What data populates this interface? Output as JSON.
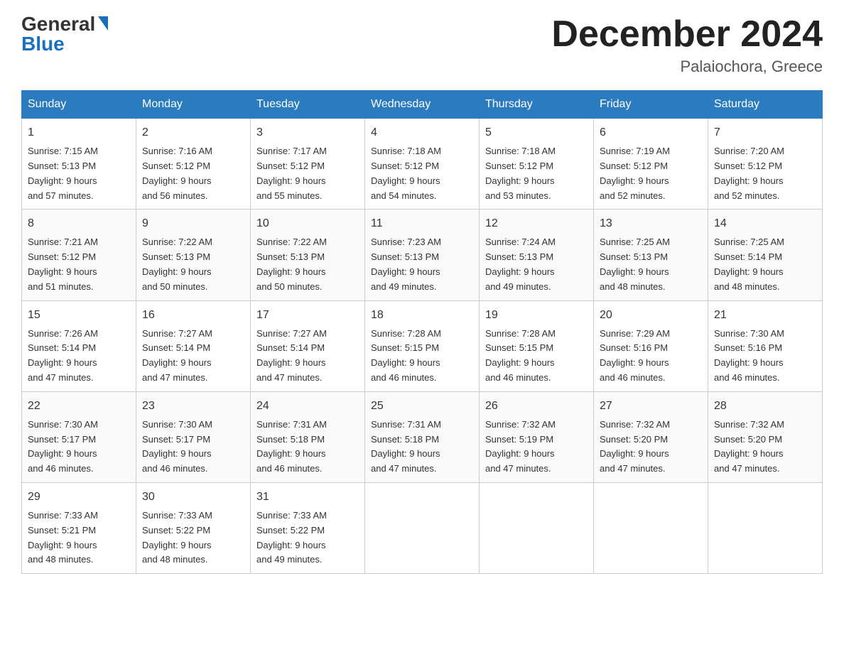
{
  "header": {
    "logo_general": "General",
    "logo_blue": "Blue",
    "month_title": "December 2024",
    "location": "Palaiochora, Greece"
  },
  "weekdays": [
    "Sunday",
    "Monday",
    "Tuesday",
    "Wednesday",
    "Thursday",
    "Friday",
    "Saturday"
  ],
  "weeks": [
    [
      {
        "day": "1",
        "sunrise": "7:15 AM",
        "sunset": "5:13 PM",
        "daylight": "9 hours and 57 minutes."
      },
      {
        "day": "2",
        "sunrise": "7:16 AM",
        "sunset": "5:12 PM",
        "daylight": "9 hours and 56 minutes."
      },
      {
        "day": "3",
        "sunrise": "7:17 AM",
        "sunset": "5:12 PM",
        "daylight": "9 hours and 55 minutes."
      },
      {
        "day": "4",
        "sunrise": "7:18 AM",
        "sunset": "5:12 PM",
        "daylight": "9 hours and 54 minutes."
      },
      {
        "day": "5",
        "sunrise": "7:18 AM",
        "sunset": "5:12 PM",
        "daylight": "9 hours and 53 minutes."
      },
      {
        "day": "6",
        "sunrise": "7:19 AM",
        "sunset": "5:12 PM",
        "daylight": "9 hours and 52 minutes."
      },
      {
        "day": "7",
        "sunrise": "7:20 AM",
        "sunset": "5:12 PM",
        "daylight": "9 hours and 52 minutes."
      }
    ],
    [
      {
        "day": "8",
        "sunrise": "7:21 AM",
        "sunset": "5:12 PM",
        "daylight": "9 hours and 51 minutes."
      },
      {
        "day": "9",
        "sunrise": "7:22 AM",
        "sunset": "5:13 PM",
        "daylight": "9 hours and 50 minutes."
      },
      {
        "day": "10",
        "sunrise": "7:22 AM",
        "sunset": "5:13 PM",
        "daylight": "9 hours and 50 minutes."
      },
      {
        "day": "11",
        "sunrise": "7:23 AM",
        "sunset": "5:13 PM",
        "daylight": "9 hours and 49 minutes."
      },
      {
        "day": "12",
        "sunrise": "7:24 AM",
        "sunset": "5:13 PM",
        "daylight": "9 hours and 49 minutes."
      },
      {
        "day": "13",
        "sunrise": "7:25 AM",
        "sunset": "5:13 PM",
        "daylight": "9 hours and 48 minutes."
      },
      {
        "day": "14",
        "sunrise": "7:25 AM",
        "sunset": "5:14 PM",
        "daylight": "9 hours and 48 minutes."
      }
    ],
    [
      {
        "day": "15",
        "sunrise": "7:26 AM",
        "sunset": "5:14 PM",
        "daylight": "9 hours and 47 minutes."
      },
      {
        "day": "16",
        "sunrise": "7:27 AM",
        "sunset": "5:14 PM",
        "daylight": "9 hours and 47 minutes."
      },
      {
        "day": "17",
        "sunrise": "7:27 AM",
        "sunset": "5:14 PM",
        "daylight": "9 hours and 47 minutes."
      },
      {
        "day": "18",
        "sunrise": "7:28 AM",
        "sunset": "5:15 PM",
        "daylight": "9 hours and 46 minutes."
      },
      {
        "day": "19",
        "sunrise": "7:28 AM",
        "sunset": "5:15 PM",
        "daylight": "9 hours and 46 minutes."
      },
      {
        "day": "20",
        "sunrise": "7:29 AM",
        "sunset": "5:16 PM",
        "daylight": "9 hours and 46 minutes."
      },
      {
        "day": "21",
        "sunrise": "7:30 AM",
        "sunset": "5:16 PM",
        "daylight": "9 hours and 46 minutes."
      }
    ],
    [
      {
        "day": "22",
        "sunrise": "7:30 AM",
        "sunset": "5:17 PM",
        "daylight": "9 hours and 46 minutes."
      },
      {
        "day": "23",
        "sunrise": "7:30 AM",
        "sunset": "5:17 PM",
        "daylight": "9 hours and 46 minutes."
      },
      {
        "day": "24",
        "sunrise": "7:31 AM",
        "sunset": "5:18 PM",
        "daylight": "9 hours and 46 minutes."
      },
      {
        "day": "25",
        "sunrise": "7:31 AM",
        "sunset": "5:18 PM",
        "daylight": "9 hours and 47 minutes."
      },
      {
        "day": "26",
        "sunrise": "7:32 AM",
        "sunset": "5:19 PM",
        "daylight": "9 hours and 47 minutes."
      },
      {
        "day": "27",
        "sunrise": "7:32 AM",
        "sunset": "5:20 PM",
        "daylight": "9 hours and 47 minutes."
      },
      {
        "day": "28",
        "sunrise": "7:32 AM",
        "sunset": "5:20 PM",
        "daylight": "9 hours and 47 minutes."
      }
    ],
    [
      {
        "day": "29",
        "sunrise": "7:33 AM",
        "sunset": "5:21 PM",
        "daylight": "9 hours and 48 minutes."
      },
      {
        "day": "30",
        "sunrise": "7:33 AM",
        "sunset": "5:22 PM",
        "daylight": "9 hours and 48 minutes."
      },
      {
        "day": "31",
        "sunrise": "7:33 AM",
        "sunset": "5:22 PM",
        "daylight": "9 hours and 49 minutes."
      },
      null,
      null,
      null,
      null
    ]
  ],
  "labels": {
    "sunrise": "Sunrise:",
    "sunset": "Sunset:",
    "daylight": "Daylight:"
  }
}
